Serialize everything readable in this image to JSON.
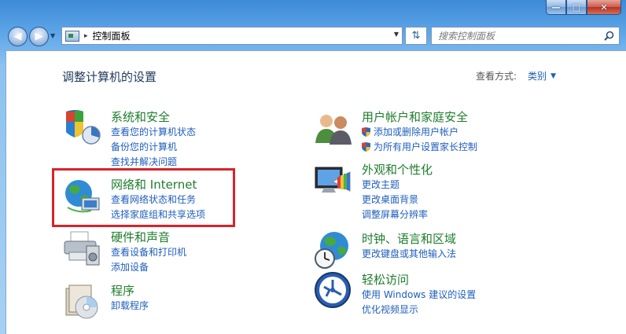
{
  "window": {
    "minimize_glyph": "—",
    "maximize_glyph": "□",
    "close_glyph": "✕"
  },
  "nav": {
    "back_glyph": "◀",
    "forward_glyph": "▶",
    "address": {
      "separator": "▸",
      "path": "控制面板"
    },
    "refresh_glyph": "⇅",
    "search": {
      "placeholder": "搜索控制面板"
    }
  },
  "header": {
    "title": "调整计算机的设置",
    "view_by_label": "查看方式:",
    "view_by_value": "类别"
  },
  "categories": [
    {
      "icon": "shield-checkmark-icon",
      "title": "系统和安全",
      "links": [
        "查看您的计算机状态",
        "备份您的计算机",
        "查找并解决问题"
      ]
    },
    {
      "icon": "globe-network-icon",
      "title": "网络和 Internet",
      "links": [
        "查看网络状态和任务",
        "选择家庭组和共享选项"
      ]
    },
    {
      "icon": "printer-icon",
      "title": "硬件和声音",
      "links": [
        "查看设备和打印机",
        "添加设备"
      ]
    },
    {
      "icon": "programs-disc-icon",
      "title": "程序",
      "links": [
        "卸载程序"
      ]
    },
    {
      "icon": "users-icon",
      "title": "用户帐户和家庭安全",
      "links": [
        "添加或删除用户帐户",
        "为所有用户设置家长控制"
      ]
    },
    {
      "icon": "monitor-palette-icon",
      "title": "外观和个性化",
      "links": [
        "更改主题",
        "更改桌面背景",
        "调整屏幕分辨率"
      ]
    },
    {
      "icon": "globe-clock-icon",
      "title": "时钟、语言和区域",
      "links": [
        "更改键盘或其他输入法"
      ]
    },
    {
      "icon": "ease-of-access-icon",
      "title": "轻松访问",
      "links": [
        "使用 Windows 建议的设置",
        "优化视频显示"
      ]
    }
  ],
  "colors": {
    "category_title": "#1e7d2c",
    "link": "#1e5ebd",
    "highlight_box": "#d8232a"
  }
}
